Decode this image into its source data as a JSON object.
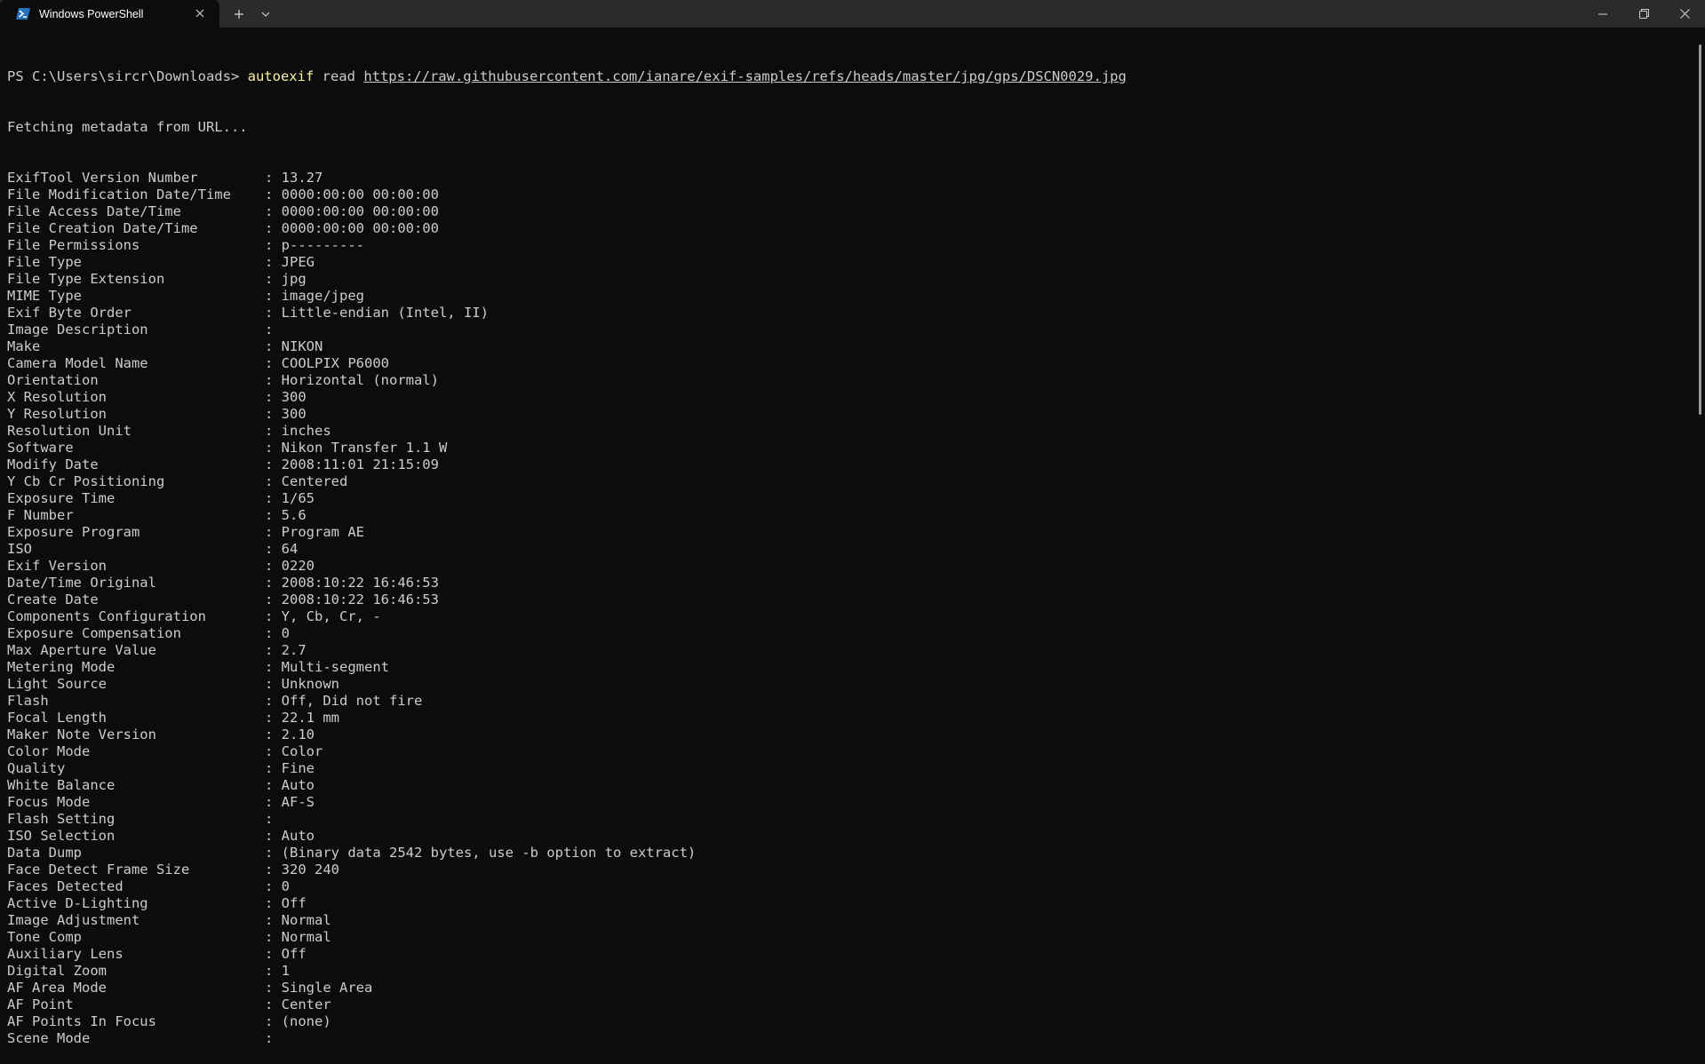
{
  "window": {
    "tab_title": "Windows PowerShell",
    "new_tab_label": "+",
    "dropdown_label": "⌄"
  },
  "terminal": {
    "prompt": "PS C:\\Users\\sircr\\Downloads>",
    "command": "autoexif",
    "arg": "read",
    "url": "https://raw.githubusercontent.com/ianare/exif-samples/refs/heads/master/jpg/gps/DSCN0029.jpg",
    "status": "Fetching metadata from URL...",
    "separator": ": ",
    "rows": [
      {
        "key": "ExifTool Version Number",
        "value": "13.27"
      },
      {
        "key": "File Modification Date/Time",
        "value": "0000:00:00 00:00:00"
      },
      {
        "key": "File Access Date/Time",
        "value": "0000:00:00 00:00:00"
      },
      {
        "key": "File Creation Date/Time",
        "value": "0000:00:00 00:00:00"
      },
      {
        "key": "File Permissions",
        "value": "p---------"
      },
      {
        "key": "File Type",
        "value": "JPEG"
      },
      {
        "key": "File Type Extension",
        "value": "jpg"
      },
      {
        "key": "MIME Type",
        "value": "image/jpeg"
      },
      {
        "key": "Exif Byte Order",
        "value": "Little-endian (Intel, II)"
      },
      {
        "key": "Image Description",
        "value": ""
      },
      {
        "key": "Make",
        "value": "NIKON"
      },
      {
        "key": "Camera Model Name",
        "value": "COOLPIX P6000"
      },
      {
        "key": "Orientation",
        "value": "Horizontal (normal)"
      },
      {
        "key": "X Resolution",
        "value": "300"
      },
      {
        "key": "Y Resolution",
        "value": "300"
      },
      {
        "key": "Resolution Unit",
        "value": "inches"
      },
      {
        "key": "Software",
        "value": "Nikon Transfer 1.1 W"
      },
      {
        "key": "Modify Date",
        "value": "2008:11:01 21:15:09"
      },
      {
        "key": "Y Cb Cr Positioning",
        "value": "Centered"
      },
      {
        "key": "Exposure Time",
        "value": "1/65"
      },
      {
        "key": "F Number",
        "value": "5.6"
      },
      {
        "key": "Exposure Program",
        "value": "Program AE"
      },
      {
        "key": "ISO",
        "value": "64"
      },
      {
        "key": "Exif Version",
        "value": "0220"
      },
      {
        "key": "Date/Time Original",
        "value": "2008:10:22 16:46:53"
      },
      {
        "key": "Create Date",
        "value": "2008:10:22 16:46:53"
      },
      {
        "key": "Components Configuration",
        "value": "Y, Cb, Cr, -"
      },
      {
        "key": "Exposure Compensation",
        "value": "0"
      },
      {
        "key": "Max Aperture Value",
        "value": "2.7"
      },
      {
        "key": "Metering Mode",
        "value": "Multi-segment"
      },
      {
        "key": "Light Source",
        "value": "Unknown"
      },
      {
        "key": "Flash",
        "value": "Off, Did not fire"
      },
      {
        "key": "Focal Length",
        "value": "22.1 mm"
      },
      {
        "key": "Maker Note Version",
        "value": "2.10"
      },
      {
        "key": "Color Mode",
        "value": "Color"
      },
      {
        "key": "Quality",
        "value": "Fine"
      },
      {
        "key": "White Balance",
        "value": "Auto"
      },
      {
        "key": "Focus Mode",
        "value": "AF-S"
      },
      {
        "key": "Flash Setting",
        "value": ""
      },
      {
        "key": "ISO Selection",
        "value": "Auto"
      },
      {
        "key": "Data Dump",
        "value": "(Binary data 2542 bytes, use -b option to extract)"
      },
      {
        "key": "Face Detect Frame Size",
        "value": "320 240"
      },
      {
        "key": "Faces Detected",
        "value": "0"
      },
      {
        "key": "Active D-Lighting",
        "value": "Off"
      },
      {
        "key": "Image Adjustment",
        "value": "Normal"
      },
      {
        "key": "Tone Comp",
        "value": "Normal"
      },
      {
        "key": "Auxiliary Lens",
        "value": "Off"
      },
      {
        "key": "Digital Zoom",
        "value": "1"
      },
      {
        "key": "AF Area Mode",
        "value": "Single Area"
      },
      {
        "key": "AF Point",
        "value": "Center"
      },
      {
        "key": "AF Points In Focus",
        "value": "(none)"
      },
      {
        "key": "Scene Mode",
        "value": ""
      }
    ]
  },
  "colors": {
    "background": "#0c0c0c",
    "titlebar": "#2b2b2b",
    "text": "#cccccc",
    "command": "#f9f1a5",
    "powershell_icon": "#2671be"
  }
}
